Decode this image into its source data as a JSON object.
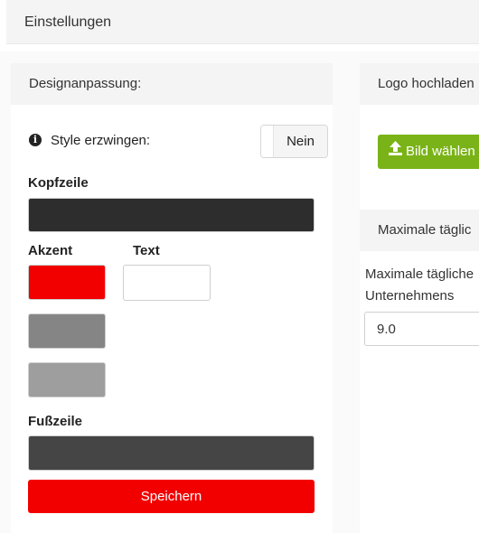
{
  "page": {
    "title": "Einstellungen"
  },
  "design": {
    "header": "Designanpassung:",
    "force_style": {
      "label": "Style erzwingen:",
      "toggle_value": "Nein"
    },
    "kopfzeile": {
      "label": "Kopfzeile",
      "color": "#2d2d2d"
    },
    "akzent": {
      "label": "Akzent",
      "colors": [
        "#f20000",
        "#858585",
        "#9e9e9e"
      ]
    },
    "text": {
      "label": "Text",
      "color": "#ffffff"
    },
    "fusszeile": {
      "label": "Fußzeile",
      "color": "#454545"
    },
    "save_label": "Speichern"
  },
  "logo": {
    "header": "Logo hochladen",
    "upload_label": "Bild wählen",
    "upload_icon": "upload-icon",
    "upload_color": "#7ab317"
  },
  "max_hours": {
    "header": "Maximale täglic",
    "label": "Maximale tägliche Unternehmens",
    "value": "9.0"
  }
}
